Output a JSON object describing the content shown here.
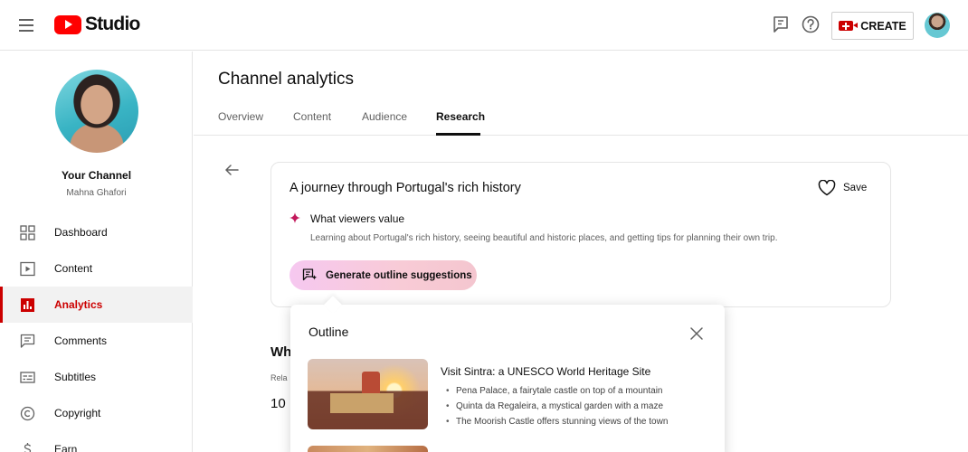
{
  "app": {
    "logo_text": "Studio",
    "create_label": "CREATE"
  },
  "channel": {
    "name": "Your Channel",
    "handle": "Mahna Ghafori"
  },
  "sidebar": {
    "items": [
      {
        "label": "Dashboard",
        "icon": "dashboard-icon"
      },
      {
        "label": "Content",
        "icon": "content-icon"
      },
      {
        "label": "Analytics",
        "icon": "analytics-icon",
        "active": true
      },
      {
        "label": "Comments",
        "icon": "comments-icon"
      },
      {
        "label": "Subtitles",
        "icon": "subtitles-icon"
      },
      {
        "label": "Copyright",
        "icon": "copyright-icon"
      },
      {
        "label": "Earn",
        "icon": "earn-icon"
      }
    ]
  },
  "page": {
    "title": "Channel analytics",
    "tabs": [
      {
        "label": "Overview"
      },
      {
        "label": "Content"
      },
      {
        "label": "Audience"
      },
      {
        "label": "Research",
        "active": true
      }
    ]
  },
  "card": {
    "title": "A journey through Portugal's rich history",
    "save_label": "Save",
    "value_heading": "What viewers value",
    "value_text": "Learning about Portugal's rich history, seeing beautiful and historic places, and getting tips for planning their own trip.",
    "generate_label": "Generate outline suggestions"
  },
  "background": {
    "heading": "Wh",
    "sub": "Rela",
    "num": "10"
  },
  "outline": {
    "title": "Outline",
    "items": [
      {
        "title": "Visit Sintra: a UNESCO World Heritage Site",
        "bullets": [
          "Pena Palace, a fairytale castle on top of a mountain",
          "Quinta da Regaleira, a mystical garden with a maze",
          "The Moorish Castle offers stunning views of the town"
        ]
      }
    ]
  },
  "colors": {
    "brand_red": "#ff0000",
    "active_red": "#cc0000",
    "gradient_pink": "#f6c8f0"
  }
}
